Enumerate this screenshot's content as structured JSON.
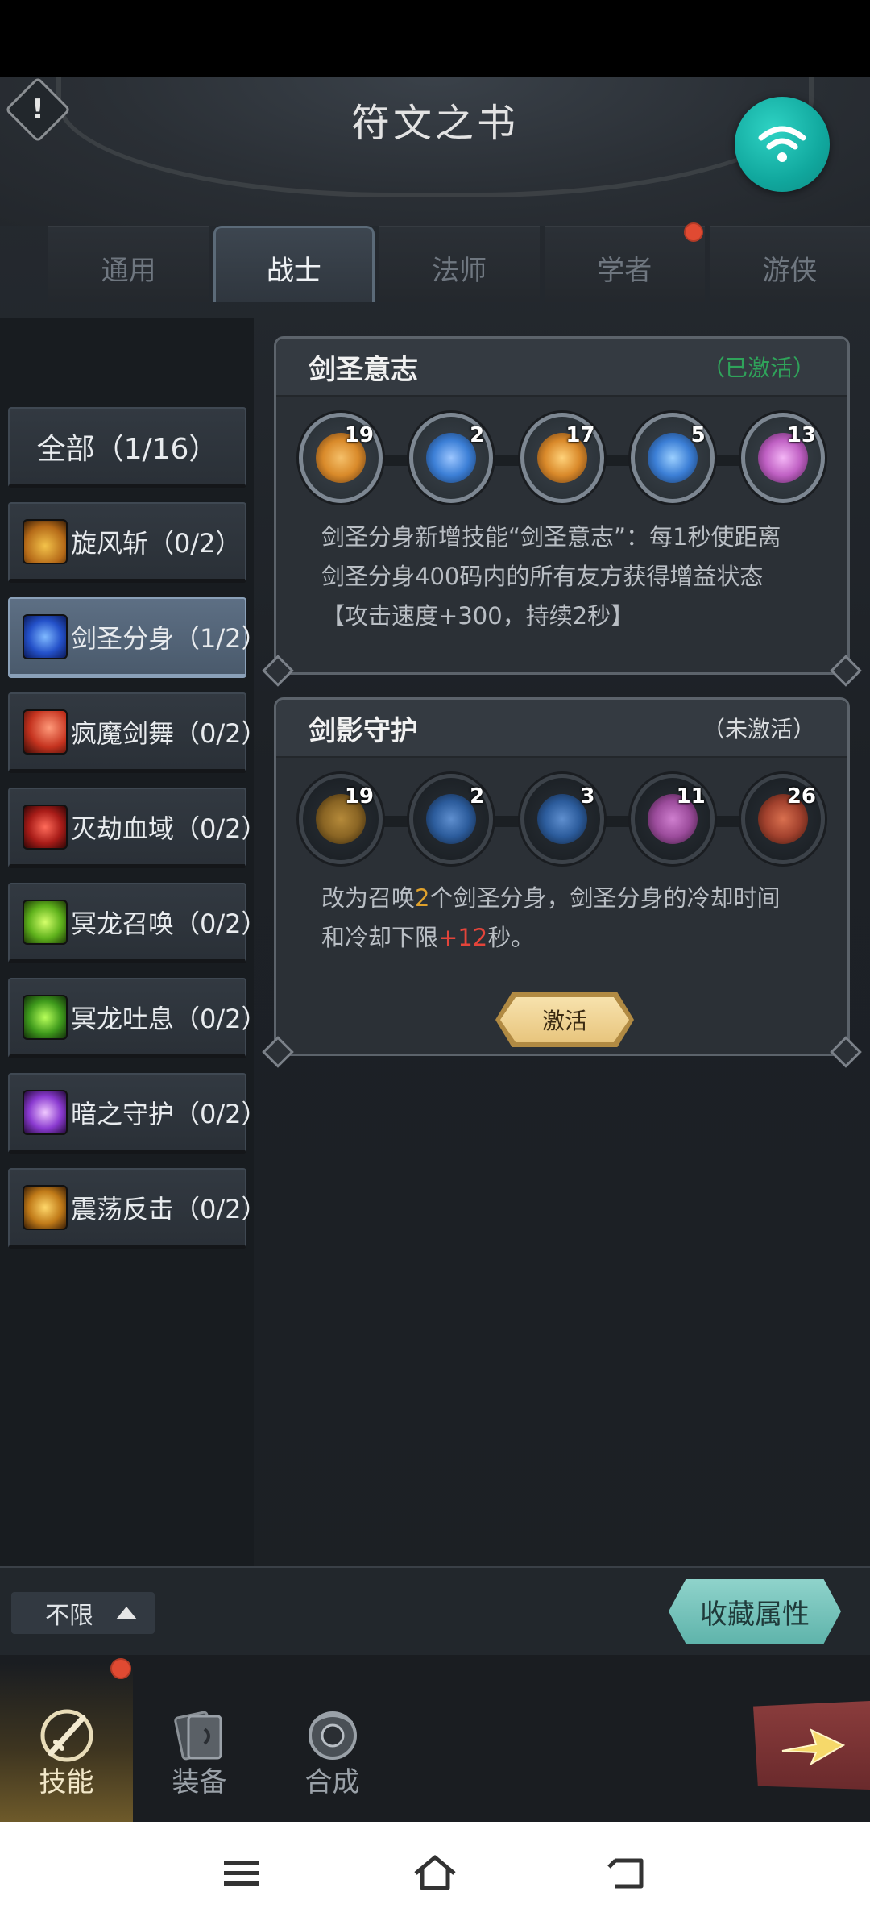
{
  "header": {
    "title": "符文之书"
  },
  "tabs": [
    {
      "label": "通用",
      "active": false
    },
    {
      "label": "战士",
      "active": true
    },
    {
      "label": "法师",
      "active": false
    },
    {
      "label": "学者",
      "active": false,
      "badge": true
    },
    {
      "label": "游侠",
      "active": false
    }
  ],
  "sidebar": {
    "all": "全部（1/16）",
    "items": [
      {
        "label": "旋风斩（0/2）",
        "icon": "whirlwind-icon"
      },
      {
        "label": "剑圣分身（1/2）",
        "icon": "blade-clone-icon",
        "selected": true
      },
      {
        "label": "疯魔剑舞（0/2）",
        "icon": "sword-dance-icon"
      },
      {
        "label": "灭劫血域（0/2）",
        "icon": "blood-domain-icon"
      },
      {
        "label": "冥龙召唤（0/2）",
        "icon": "dragon-summon-icon"
      },
      {
        "label": "冥龙吐息（0/2）",
        "icon": "dragon-breath-icon"
      },
      {
        "label": "暗之守护（0/2）",
        "icon": "dark-guard-icon"
      },
      {
        "label": "震荡反击（0/2）",
        "icon": "shock-counter-icon"
      }
    ]
  },
  "cards": [
    {
      "title": "剑圣意志",
      "status": "（已激活）",
      "runes": [
        {
          "count": "19",
          "icon": "swirl-rune-icon",
          "color": "#d98a2a"
        },
        {
          "count": "2",
          "icon": "water-rune-icon",
          "color": "#3c7fd6"
        },
        {
          "count": "17",
          "icon": "lightning-rune-icon",
          "color": "#d9892a"
        },
        {
          "count": "5",
          "icon": "fist-rune-icon",
          "color": "#3c7fd6"
        },
        {
          "count": "13",
          "icon": "feather-rune-icon",
          "color": "#c061c4"
        }
      ],
      "desc": "剑圣分身新增技能“剑圣意志”：每1秒使距离剑圣分身400码内的所有友方获得增益状态【攻击速度+300，持续2秒】"
    },
    {
      "title": "剑影守护",
      "status": "（未激活）",
      "runes": [
        {
          "count": "19",
          "icon": "swirl-rune-icon",
          "color": "#8a6524"
        },
        {
          "count": "2",
          "icon": "water-rune-icon",
          "color": "#2c5c9c"
        },
        {
          "count": "3",
          "icon": "flame-rune-icon",
          "color": "#2c5c9c"
        },
        {
          "count": "11",
          "icon": "scroll-rune-icon",
          "color": "#9c4c9c"
        },
        {
          "count": "26",
          "icon": "triangle-rune-icon",
          "color": "#a3422e"
        }
      ],
      "desc_parts": [
        "改为召唤",
        "2",
        "个剑圣分身，剑圣分身的冷却时间和冷却下限",
        "+12",
        "秒。"
      ],
      "button": "激活"
    }
  ],
  "filter": {
    "label": "不限"
  },
  "collect_button": "收藏属性",
  "bottom_nav": [
    {
      "label": "技能",
      "active": true,
      "badge": true
    },
    {
      "label": "装备",
      "active": false
    },
    {
      "label": "合成",
      "active": false
    }
  ],
  "colors": {
    "active_status": "#2fa35a",
    "highlight_gold": "#e0a12c",
    "highlight_red": "#e4443a",
    "wifi": "#11a89e"
  }
}
